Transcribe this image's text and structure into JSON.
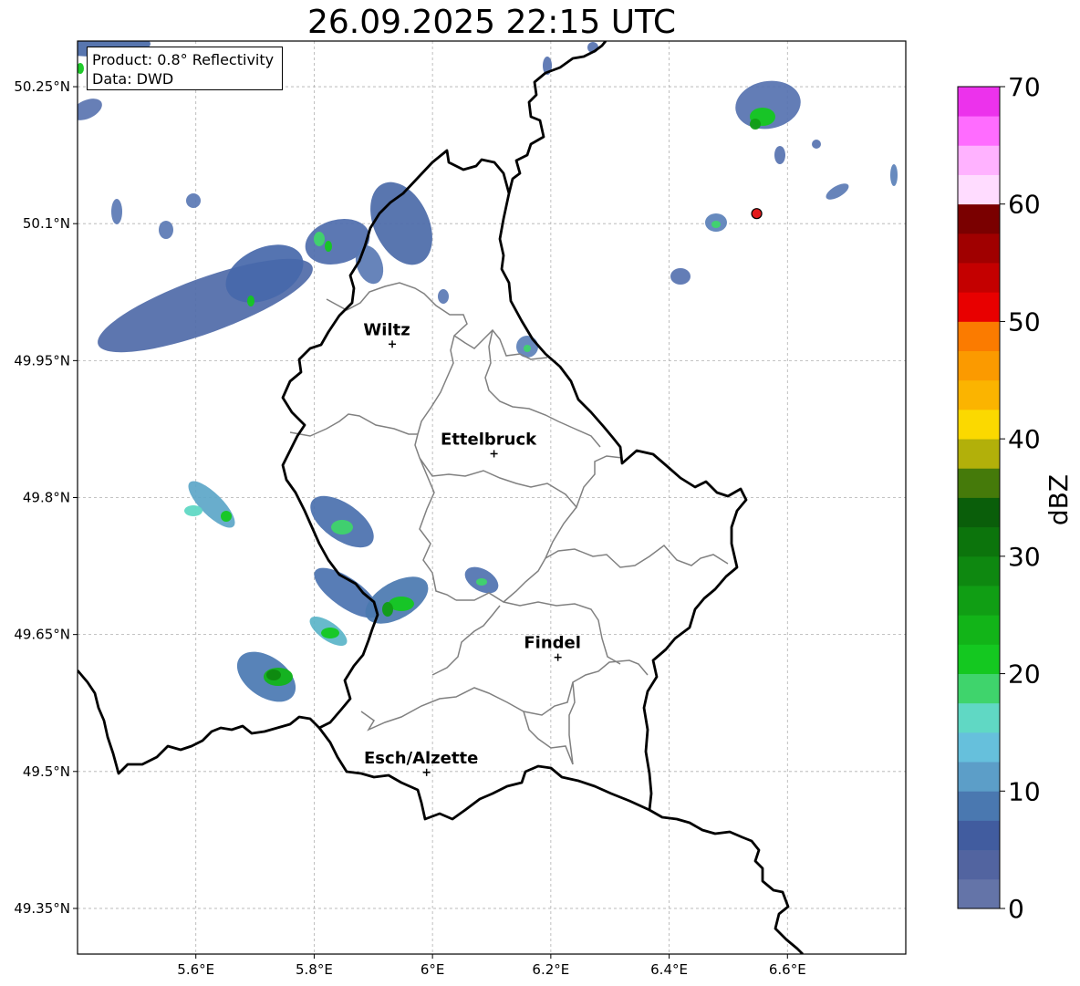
{
  "title": "26.09.2025 22:15 UTC",
  "info_box": {
    "product": "Product: 0.8° Reflectivity",
    "source": "Data: DWD"
  },
  "axes": {
    "lon_ticks": [
      {
        "value": 5.6,
        "label": "5.6°E"
      },
      {
        "value": 5.8,
        "label": "5.8°E"
      },
      {
        "value": 6.0,
        "label": "6°E"
      },
      {
        "value": 6.2,
        "label": "6.2°E"
      },
      {
        "value": 6.4,
        "label": "6.4°E"
      },
      {
        "value": 6.6,
        "label": "6.6°E"
      }
    ],
    "lat_ticks": [
      {
        "value": 50.25,
        "label": "50.25°N"
      },
      {
        "value": 50.1,
        "label": "50.1°N"
      },
      {
        "value": 49.95,
        "label": "49.95°N"
      },
      {
        "value": 49.8,
        "label": "49.8°N"
      },
      {
        "value": 49.65,
        "label": "49.65°N"
      },
      {
        "value": 49.5,
        "label": "49.5°N"
      },
      {
        "value": 49.35,
        "label": "49.35°N"
      }
    ],
    "lon_range": [
      5.4,
      6.8
    ],
    "lat_range": [
      49.3,
      50.3
    ]
  },
  "cities": [
    {
      "name": "Wiltz",
      "lon": 5.932,
      "lat": 49.968
    },
    {
      "name": "Ettelbruck",
      "lon": 6.104,
      "lat": 49.848
    },
    {
      "name": "Findel",
      "lon": 6.212,
      "lat": 49.625
    },
    {
      "name": "Esch/Alzette",
      "lon": 5.99,
      "lat": 49.499
    }
  ],
  "radar_site": {
    "lon": 6.548,
    "lat": 50.111,
    "color": "#e31a1c"
  },
  "colorbar": {
    "label": "dBZ",
    "min": 0,
    "max": 70,
    "tick_labels": [
      "0",
      "10",
      "20",
      "30",
      "40",
      "50",
      "60",
      "70"
    ],
    "colors": [
      "#6474a8",
      "#5264a0",
      "#415c9f",
      "#4a78b0",
      "#5c9ec8",
      "#66c0dc",
      "#60d8c4",
      "#3fd46c",
      "#14c820",
      "#12b418",
      "#109e14",
      "#0e8810",
      "#0c740c",
      "#0a5e0a",
      "#457a0a",
      "#b2b00a",
      "#fbd900",
      "#fbb400",
      "#fb9a00",
      "#fb7b00",
      "#e80000",
      "#c40000",
      "#a00000",
      "#7a0000",
      "#ffdcff",
      "#ffb2ff",
      "#ff6cff",
      "#ec32ec"
    ]
  },
  "colors": {
    "country_border": "#000000",
    "canton_border": "#808080",
    "grid": "#b0b0b0"
  }
}
